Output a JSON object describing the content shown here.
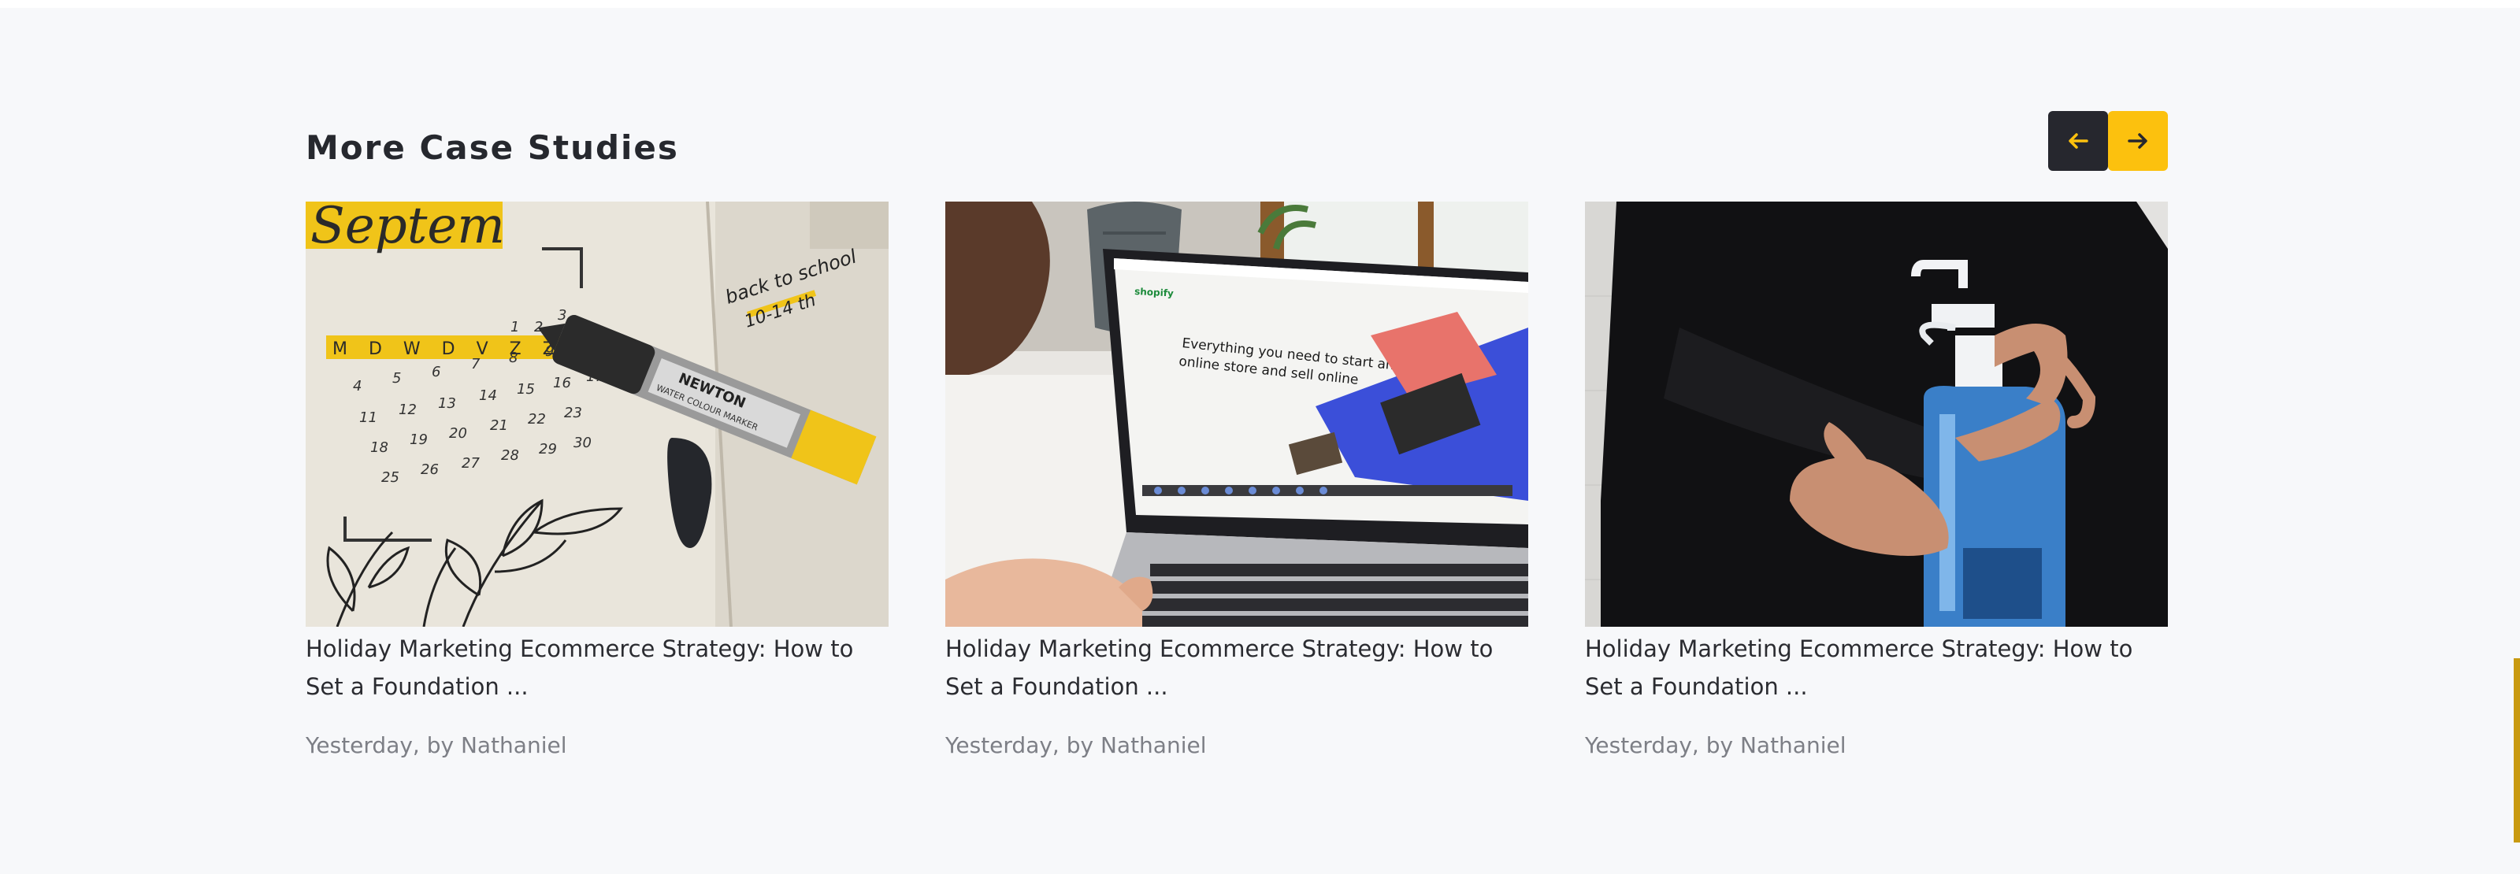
{
  "section": {
    "title": "More Case Studies",
    "nav": {
      "prev_icon": "arrow-left-icon",
      "next_icon": "arrow-right-icon",
      "prev_bg": "#26272e",
      "next_bg": "#fcc10e",
      "arrow_color": "#fcc10e"
    }
  },
  "cards": [
    {
      "image": "calendar-notebook-marker-photo",
      "title": "Holiday Marketing Ecommerce Strategy: How to Set a Foundation ...",
      "meta": "Yesterday, by Nathaniel"
    },
    {
      "image": "laptop-ecommerce-store-photo",
      "title": "Holiday Marketing Ecommerce Strategy: How to Set a Foundation ...",
      "meta": "Yesterday, by Nathaniel"
    },
    {
      "image": "hand-sanitizer-bottle-photo",
      "title": "Holiday Marketing Ecommerce Strategy: How to Set a Foundation ...",
      "meta": "Yesterday, by Nathaniel"
    }
  ],
  "image_text": {
    "calendar_month": "Septem",
    "calendar_days": "M D W D V Z Z",
    "calendar_note": "back to school",
    "calendar_note_date": "10-14 th",
    "marker_brand": "NEWTON",
    "marker_label": "WATER COLOUR MARKER",
    "laptop_brand": "shopify",
    "laptop_headline_1": "Everything you need to start an",
    "laptop_headline_2": "online store and sell online"
  },
  "colors": {
    "background": "#f7f8fa",
    "title": "#26282e",
    "meta": "#7d7f86",
    "accent": "#fcc10e"
  }
}
